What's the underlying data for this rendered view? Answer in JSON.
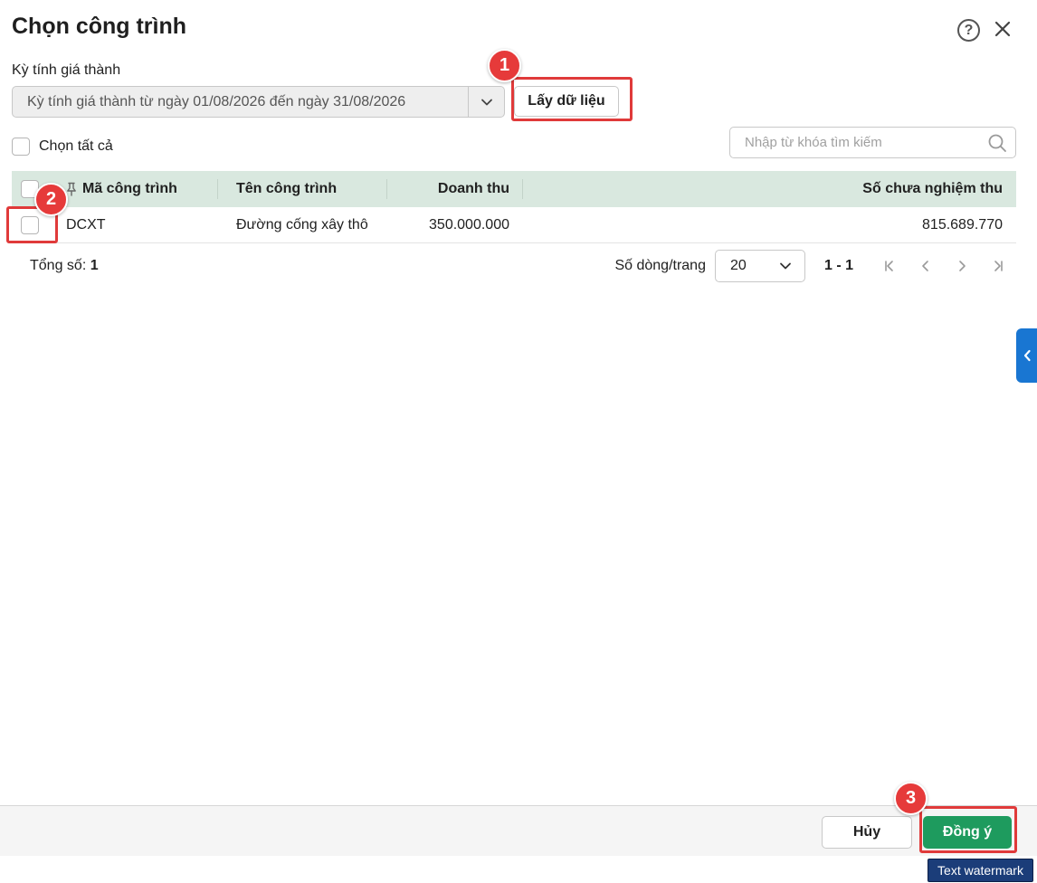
{
  "dialog": {
    "title": "Chọn công trình"
  },
  "period": {
    "label": "Kỳ tính giá thành",
    "value": "Kỳ tính giá thành từ ngày 01/08/2026 đến ngày 31/08/2026",
    "fetch_label": "Lấy dữ liệu"
  },
  "select_all": {
    "label": "Chọn tất cả"
  },
  "search": {
    "placeholder": "Nhập từ khóa tìm kiếm"
  },
  "grid": {
    "columns": {
      "code": "Mã công trình",
      "name": "Tên công trình",
      "revenue": "Doanh thu",
      "unaccepted": "Số chưa nghiệm thu"
    },
    "rows": [
      {
        "code": "DCXT",
        "name": "Đường cống xây thô",
        "revenue": "350.000.000",
        "unaccepted": "815.689.770"
      }
    ]
  },
  "footer": {
    "total_label": "Tổng số:",
    "total_value": "1",
    "rows_label": "Số dòng/trang",
    "rows_per_page": "20",
    "range": "1 - 1"
  },
  "actions": {
    "cancel_label": "Hủy",
    "ok_label": "Đồng ý"
  },
  "annotations": {
    "badge_1": "1",
    "badge_2": "2",
    "badge_3": "3"
  },
  "watermark": "Text watermark",
  "colors": {
    "accent_green": "#1e9b5e",
    "header_bg": "#d9e8df",
    "highlight_red": "#e03a3a",
    "side_tab_blue": "#1976d2"
  },
  "icons": {
    "help": "question-circle-icon",
    "close": "close-x-icon",
    "dropdown": "chevron-down-icon",
    "search": "magnifier-icon",
    "pin": "pin-icon",
    "side_tab": "chevron-left-icon"
  }
}
